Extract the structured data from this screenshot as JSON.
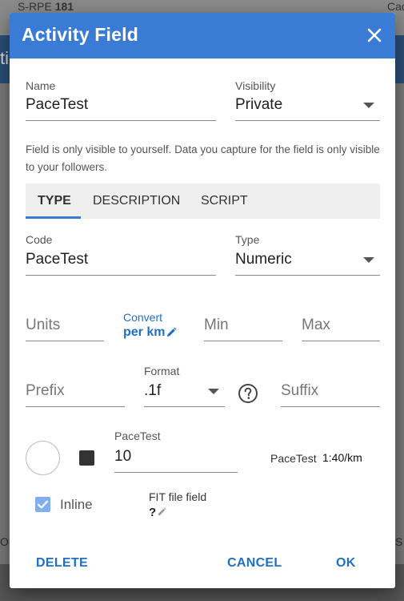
{
  "background": {
    "top_left_label": "S-RPE",
    "top_left_value": "181",
    "top_right_fragment": "Cad",
    "bar_fragment": "ti",
    "side_left_fragment": "OD",
    "side_right_fragment": "S"
  },
  "dialog": {
    "title": "Activity Field",
    "close_icon": "close-icon",
    "header_color": "#3a7bd5"
  },
  "name_field": {
    "label": "Name",
    "value": "PaceTest"
  },
  "visibility_field": {
    "label": "Visibility",
    "value": "Private"
  },
  "info_text": "Field is only visible to yourself. Data you capture for the field is only visible to your followers.",
  "tabs": [
    {
      "label": "TYPE",
      "active": true
    },
    {
      "label": "DESCRIPTION",
      "active": false
    },
    {
      "label": "SCRIPT",
      "active": false
    }
  ],
  "code_field": {
    "label": "Code",
    "value": "PaceTest"
  },
  "type_field": {
    "label": "Type",
    "value": "Numeric"
  },
  "units_field": {
    "placeholder": "Units"
  },
  "convert": {
    "label": "Convert",
    "value": "per km"
  },
  "min_field": {
    "placeholder": "Min"
  },
  "max_field": {
    "placeholder": "Max"
  },
  "prefix_field": {
    "placeholder": "Prefix"
  },
  "format_field": {
    "label": "Format",
    "value": ".1f"
  },
  "suffix_field": {
    "placeholder": "Suffix"
  },
  "value_field": {
    "label": "PaceTest",
    "value": "10"
  },
  "preview": {
    "name": "PaceTest",
    "value": "1:40/km"
  },
  "inline_checkbox": {
    "label": "Inline",
    "checked": true
  },
  "fit_field": {
    "label": "FIT file field",
    "value": "?"
  },
  "actions": {
    "delete": "DELETE",
    "cancel": "CANCEL",
    "ok": "OK"
  },
  "colors": {
    "accent": "#3a7bd5",
    "link": "#1f6fc4",
    "checkbox": "#82aef0"
  }
}
